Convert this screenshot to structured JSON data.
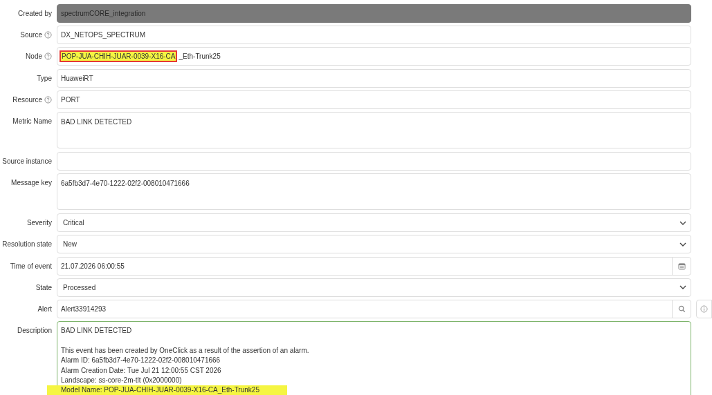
{
  "fields": [
    {
      "label": "Created by",
      "help": false,
      "kind": "readonly",
      "value": "spectrumCORE_integration"
    },
    {
      "label": "Source",
      "help": true,
      "kind": "text",
      "value": "DX_NETOPS_SPECTRUM"
    },
    {
      "label": "Node",
      "help": true,
      "kind": "text",
      "segments": [
        {
          "text": "POP-JUA-CHIH-JUAR-0039-X16-CA",
          "highlighted": true
        },
        {
          "text": "_Eth-Trunk25",
          "highlighted": false
        }
      ]
    },
    {
      "label": "Type",
      "help": false,
      "kind": "text",
      "value": "HuaweiRT"
    },
    {
      "label": "Resource",
      "help": true,
      "kind": "text",
      "value": "PORT"
    },
    {
      "label": "Metric Name",
      "help": false,
      "kind": "textarea",
      "value": "BAD LINK DETECTED"
    },
    {
      "label": "Source instance",
      "help": false,
      "kind": "text"
    },
    {
      "label": "Message key",
      "help": false,
      "kind": "textarea",
      "value": "6a5fb3d7-4e70-1222-02f2-008010471666"
    },
    {
      "label": "Severity",
      "help": false,
      "kind": "select",
      "value": "Critical"
    },
    {
      "label": "Resolution state",
      "help": false,
      "kind": "select",
      "value": "New"
    },
    {
      "label": "Time of event",
      "help": false,
      "kind": "date",
      "value": "21.07.2026 06:00:55"
    },
    {
      "label": "State",
      "help": false,
      "kind": "select",
      "value": "Processed"
    },
    {
      "label": "Alert",
      "help": false,
      "kind": "lookup",
      "value": "Alert33914293"
    },
    {
      "label": "Description",
      "help": false,
      "kind": "description",
      "lines": [
        {
          "text": "BAD LINK DETECTED",
          "highlighted": false
        },
        {
          "text": "This event has been created by OneClick as a result of the assertion of an alarm.",
          "highlighted": false,
          "gap": true
        },
        {
          "text": "Alarm ID: 6a5fb3d7-4e70-1222-02f2-008010471666",
          "highlighted": false
        },
        {
          "text": "Alarm Creation Date: Tue Jul 21 12:00:55 CST 2026",
          "highlighted": false
        },
        {
          "text": "Landscape: ss-core-2m-tlt (0x2000000)",
          "highlighted": false
        },
        {
          "text": "Model Name: POP-JUA-CHIH-JUAR-0039-X16-CA_Eth-Trunk25",
          "highlighted": true
        }
      ]
    }
  ]
}
